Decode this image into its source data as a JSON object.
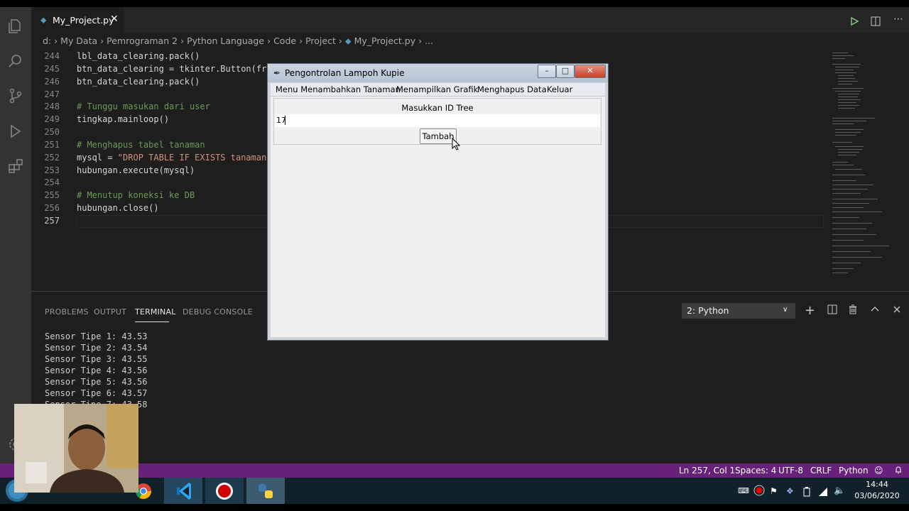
{
  "editor": {
    "tab_label": "My_Project.py",
    "breadcrumb": [
      "d:",
      "My Data",
      "Pemrograman 2",
      "Python Language",
      "Code",
      "Project",
      "My_Project.py",
      "..."
    ],
    "lines": [
      {
        "num": "244",
        "code": "lbl_data_clearing.pack()"
      },
      {
        "num": "245",
        "code": "btn_data_clearing = tkinter.Button(fr"
      },
      {
        "num": "246",
        "code": "btn_data_clearing.pack()"
      },
      {
        "num": "247",
        "code": ""
      },
      {
        "num": "248",
        "code": "# Tunggu masukan dari user"
      },
      {
        "num": "249",
        "code": "tingkap.mainloop()"
      },
      {
        "num": "250",
        "code": ""
      },
      {
        "num": "251",
        "code": "# Menghapus tabel tanaman"
      },
      {
        "num": "252",
        "code_pre": "mysql = ",
        "code_str": "\"DROP TABLE IF EXISTS tanaman"
      },
      {
        "num": "253",
        "code": "hubungan.execute(mysql)"
      },
      {
        "num": "254",
        "code": ""
      },
      {
        "num": "255",
        "code": "# Menutup koneksi ke DB"
      },
      {
        "num": "256",
        "code": "hubungan.close()"
      },
      {
        "num": "257",
        "code": ""
      }
    ]
  },
  "panel": {
    "tabs": [
      "PROBLEMS",
      "OUTPUT",
      "TERMINAL",
      "DEBUG CONSOLE"
    ],
    "terminal_select": "2: Python",
    "terminal_lines": [
      "Sensor Tipe 1: 43.53",
      "Sensor Tipe 2: 43.54",
      "Sensor Tipe 3: 43.55",
      "Sensor Tipe 4: 43.56",
      "Sensor Tipe 5: 43.56",
      "Sensor Tipe 6: 43.57",
      "Sensor Tipe 7: 43.58"
    ]
  },
  "statusbar": {
    "position": "Ln 257, Col 1",
    "spaces": "Spaces: 4",
    "encoding": "UTF-8",
    "eol": "CRLF",
    "language": "Python"
  },
  "taskbar": {
    "time": "14:44",
    "date": "03/06/2020"
  },
  "tk_window": {
    "title": "Pengontrolan Lampoh Kupie",
    "menu": [
      "Menu Menambahkan Tanaman",
      "Menampilkan Grafik",
      "Menghapus Data",
      "Keluar"
    ],
    "label": "Masukkan ID Tree",
    "entry_value": "17",
    "button_label": "Tambah"
  }
}
